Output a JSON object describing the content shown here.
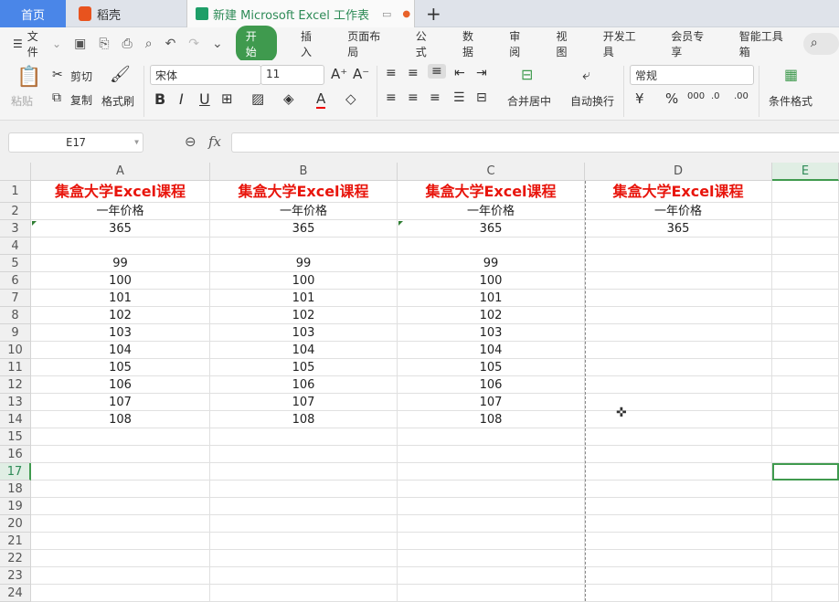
{
  "tabs": {
    "home": "首页",
    "daoke": "稻壳",
    "file": "新建 Microsoft Excel 工作表"
  },
  "menu": {
    "file": "文件",
    "start": "开始",
    "items": [
      "插入",
      "页面布局",
      "公式",
      "数据",
      "审阅",
      "视图",
      "开发工具",
      "会员专享",
      "智能工具箱"
    ]
  },
  "ribbon": {
    "paste": "粘贴",
    "cut": "剪切",
    "copy": "复制",
    "format_painter": "格式刷",
    "font": "宋体",
    "size": "11",
    "merge": "合并居中",
    "wrap": "自动换行",
    "number_format": "常规",
    "cond_format": "条件格式",
    "currency": "¥",
    "percent": "%"
  },
  "formula_bar": {
    "cell_ref": "E17",
    "fx": "fx",
    "value": ""
  },
  "sheet": {
    "columns": [
      "A",
      "B",
      "C",
      "D",
      "E"
    ],
    "selected_cell": "E17",
    "rows": [
      [
        "集盒大学Excel课程",
        "集盒大学Excel课程",
        "集盒大学Excel课程",
        "集盒大学Excel课程",
        ""
      ],
      [
        "一年价格",
        "一年价格",
        "一年价格",
        "一年价格",
        ""
      ],
      [
        "365",
        "365",
        "365",
        "365",
        ""
      ],
      [
        "",
        "",
        "",
        "",
        ""
      ],
      [
        "99",
        "99",
        "99",
        "",
        ""
      ],
      [
        "100",
        "100",
        "100",
        "",
        ""
      ],
      [
        "101",
        "101",
        "101",
        "",
        ""
      ],
      [
        "102",
        "102",
        "102",
        "",
        ""
      ],
      [
        "103",
        "103",
        "103",
        "",
        ""
      ],
      [
        "104",
        "104",
        "104",
        "",
        ""
      ],
      [
        "105",
        "105",
        "105",
        "",
        ""
      ],
      [
        "106",
        "106",
        "106",
        "",
        ""
      ],
      [
        "107",
        "107",
        "107",
        "",
        ""
      ],
      [
        "108",
        "108",
        "108",
        "",
        ""
      ],
      [
        "",
        "",
        "",
        "",
        ""
      ],
      [
        "",
        "",
        "",
        "",
        ""
      ],
      [
        "",
        "",
        "",
        "",
        ""
      ],
      [
        "",
        "",
        "",
        "",
        ""
      ],
      [
        "",
        "",
        "",
        "",
        ""
      ],
      [
        "",
        "",
        "",
        "",
        ""
      ],
      [
        "",
        "",
        "",
        "",
        ""
      ],
      [
        "",
        "",
        "",
        "",
        ""
      ],
      [
        "",
        "",
        "",
        "",
        ""
      ],
      [
        "",
        "",
        "",
        "",
        ""
      ]
    ]
  },
  "colors": {
    "accent": "#3f9a4e",
    "title_red": "#e8150c"
  }
}
